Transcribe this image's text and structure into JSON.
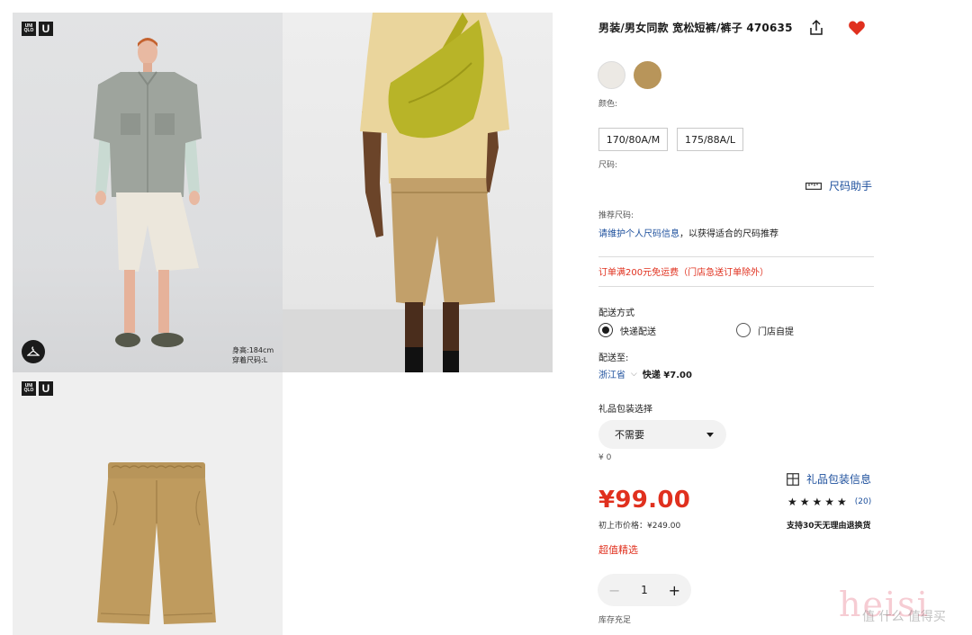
{
  "product": {
    "title": "男装/男女同款 宽松短裤/裤子 470635",
    "colors_label": "颜色:",
    "colors": [
      "#ece9e4",
      "#b8955a"
    ],
    "sizes": [
      "170/80A/M",
      "175/88A/L"
    ],
    "size_label": "尺码:",
    "size_help": "尺码助手",
    "recommend_label": "推荐尺码:",
    "recommend_link": "请维护个人尺码信息",
    "recommend_suffix": "，以获得适合的尺码推荐",
    "promo": "订单满200元免运费（门店急送订单除外）"
  },
  "delivery": {
    "title": "配送方式",
    "option_express": "快递配送",
    "option_pickup": "门店自提",
    "selected": "快递配送",
    "to_label": "配送至:",
    "province": "浙江省",
    "shipping": "快递 ¥7.00"
  },
  "gift": {
    "title": "礼品包装选择",
    "selected": "不需要",
    "price": "¥ 0",
    "info": "礼品包装信息"
  },
  "pricing": {
    "price": "¥99.00",
    "original": "初上市价格：¥249.00",
    "deal": "超值精选",
    "stars": "★★★★★",
    "rating_count": "(20)",
    "returns": "支持30天无理由退换货"
  },
  "quantity": {
    "value": "1",
    "minus": "−",
    "plus": "+",
    "stock": "库存充足"
  },
  "gallery": {
    "model_height": "身高:184cm",
    "model_size": "穿着尺码:L",
    "logo_grid_top": "UNI",
    "logo_grid_bottom": "QLO",
    "logo_u": "U"
  },
  "watermark": {
    "main": "heisi",
    "sub": "值 什么 值得买"
  },
  "icons": {
    "share": "share-icon",
    "favorite": "heart-icon",
    "ruler": "ruler-icon",
    "gift": "gift-box-icon",
    "hanger": "hanger-icon"
  },
  "colors": {
    "accent_red": "#e0301e",
    "link_blue": "#1c4f9c",
    "khaki": "#b8955a"
  }
}
